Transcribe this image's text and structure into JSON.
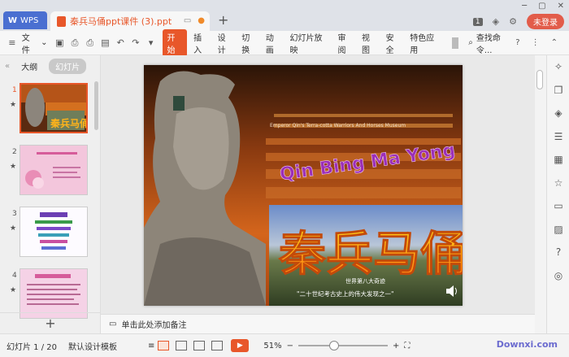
{
  "titlebar": {
    "app_name": "WPS",
    "doc_title": "秦兵马俑ppt课件 (3).ppt",
    "new_tab": "+",
    "slide_count_badge": "1",
    "login_label": "未登录"
  },
  "ribbon": {
    "file_label": "文件",
    "tabs": [
      "开始",
      "插入",
      "设计",
      "切换",
      "动画",
      "幻灯片放映",
      "审阅",
      "视图",
      "安全",
      "特色应用"
    ],
    "search_label": "查找命令...",
    "help_label": "?"
  },
  "left_panel": {
    "tab_outline": "大纲",
    "tab_slides": "幻灯片",
    "thumb_numbers": [
      "1",
      "2",
      "3",
      "4"
    ],
    "add_label": "+"
  },
  "slide": {
    "subtitle_en": "Emperor Qin's Terra-cotta Warriors And Horses Museum",
    "title_pinyin": "Qin Bing Ma Yong",
    "title_cn": "秦兵马俑",
    "caption_prefix": "世界第八大奇迹",
    "caption_quote": "\"二十世纪考古史上的伟大发现之一\""
  },
  "notes": {
    "placeholder": "单击此处添加备注"
  },
  "statusbar": {
    "slide_info": "幻灯片 1 / 20",
    "template": "默认设计模板",
    "zoom": "51%",
    "watermark": "Downxi.com"
  },
  "colors": {
    "accent": "#e8572a",
    "wps_blue": "#4a6fd1",
    "login_red": "#e25c4a"
  },
  "icons": {
    "right_sidebar": [
      "pin-icon",
      "copy-icon",
      "shapes-icon",
      "sliders-icon",
      "clipboard-icon",
      "star-icon",
      "box-icon",
      "image-icon",
      "help-icon",
      "bell-icon"
    ]
  }
}
